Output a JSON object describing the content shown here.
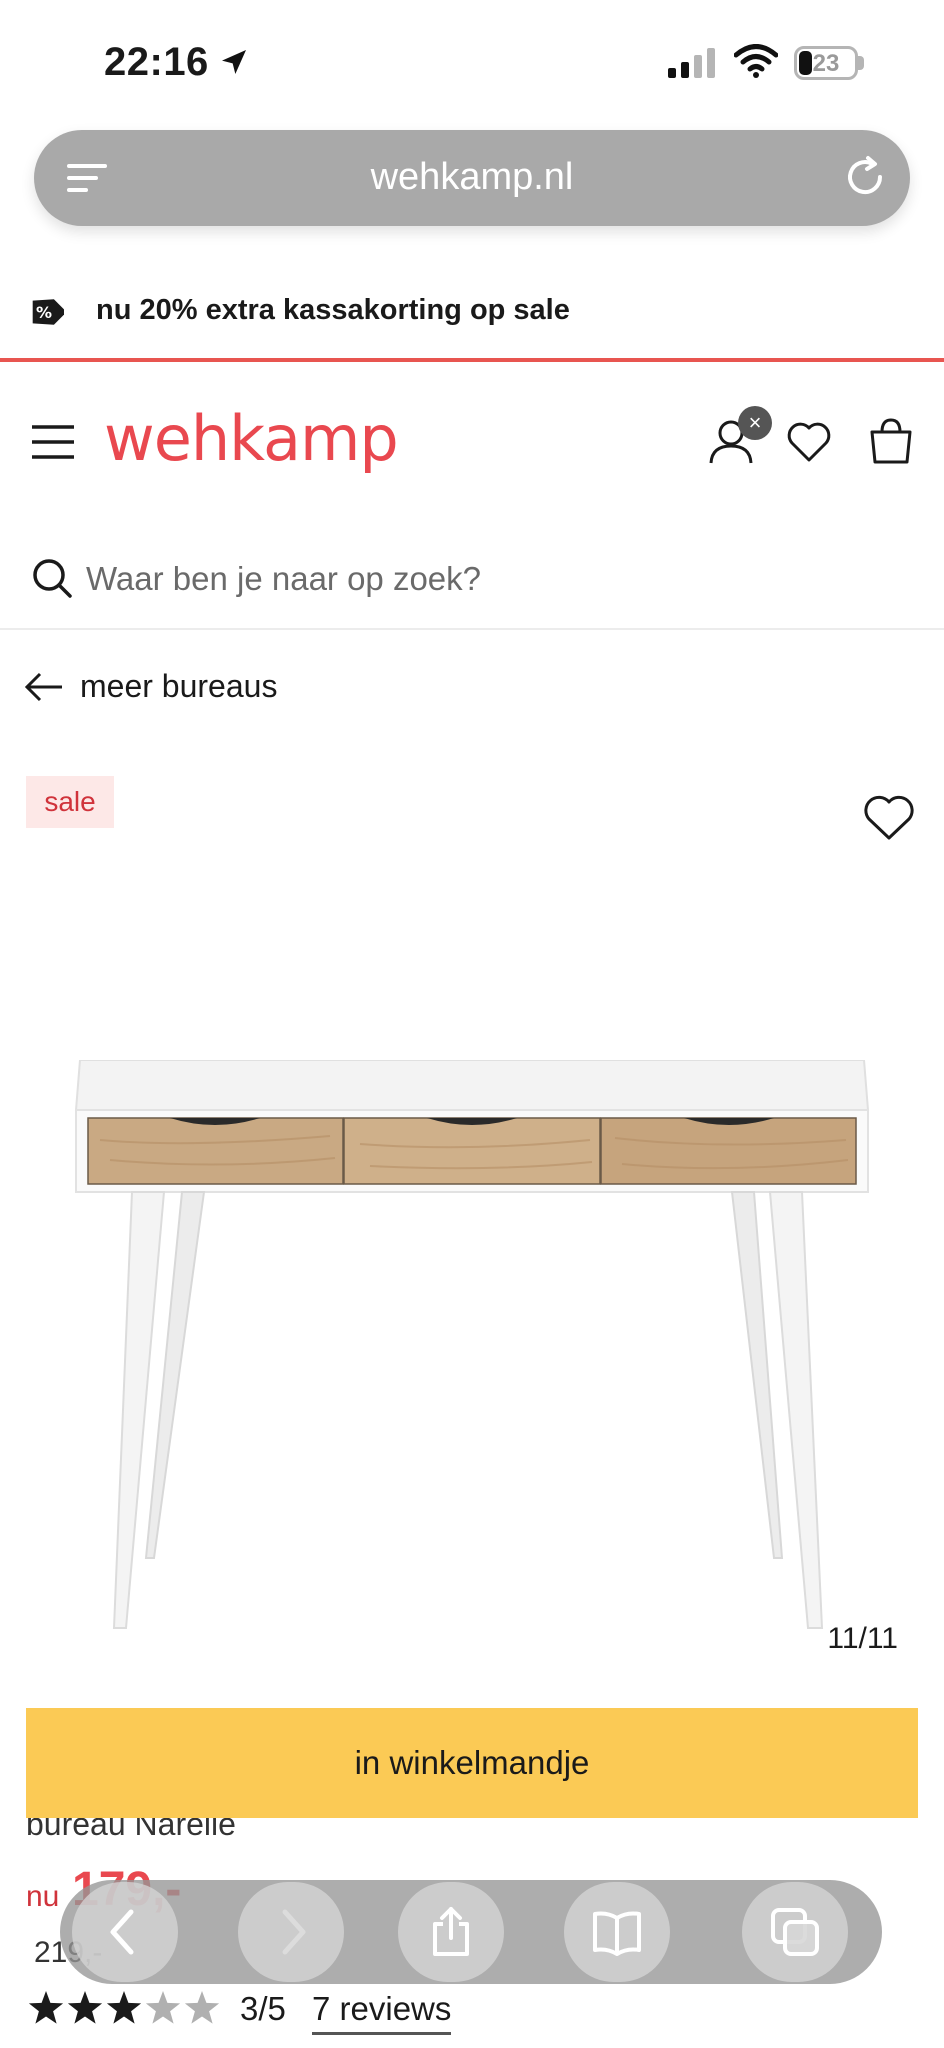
{
  "status_bar": {
    "time": "22:16",
    "battery": "23",
    "battery_level": 0.23
  },
  "browser": {
    "url": "wehkamp.nl"
  },
  "promo": {
    "text": "nu 20% extra kassakorting op sale",
    "icon": "discount-tag-icon"
  },
  "header": {
    "logo": "wehkamp",
    "user_badge": "×",
    "icons": [
      "hamburger-icon",
      "user-icon",
      "heart-icon",
      "shopping-bag-icon"
    ]
  },
  "search": {
    "placeholder": "Waar ben je naar op zoek?"
  },
  "breadcrumb": {
    "back_label": "meer bureaus"
  },
  "product": {
    "badge": "sale",
    "image_counter": "11/11",
    "name": "bureau Narelle",
    "price_prefix": "nu",
    "price_now": "179,-",
    "price_old": "219,-",
    "rating_score": "3/5",
    "rating_value": 3,
    "rating_max": 5,
    "reviews_label": "7 reviews"
  },
  "cart": {
    "button_label": "in winkelmandje"
  },
  "toolbar": {
    "icons": [
      "back-icon",
      "forward-icon",
      "share-icon",
      "bookmarks-icon",
      "tabs-icon"
    ]
  },
  "colors": {
    "brand": "#e9484f",
    "cart_button": "#fbca55",
    "sale_badge_bg": "#fde8e7",
    "sale_text": "#d0333b"
  }
}
